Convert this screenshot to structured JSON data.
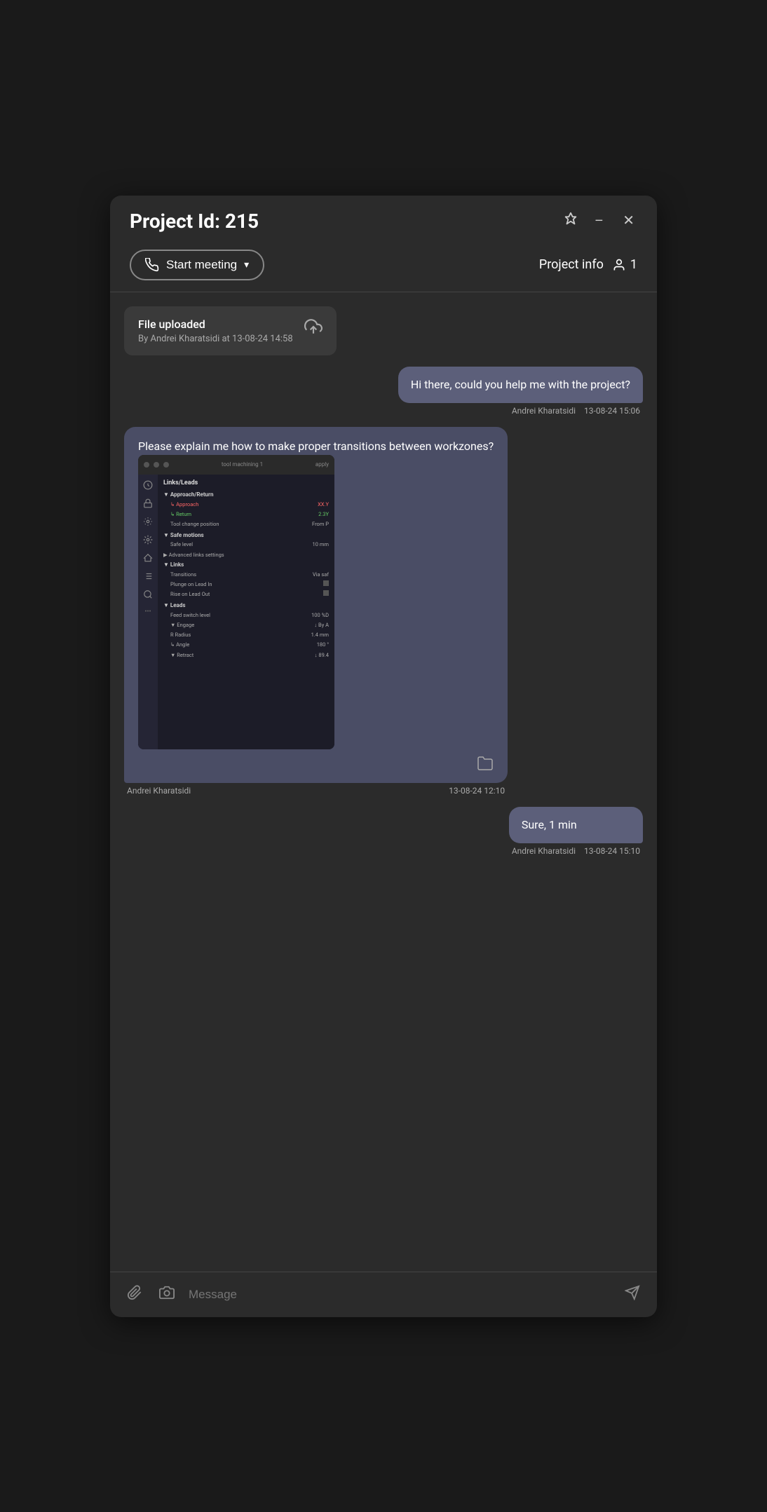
{
  "window": {
    "title": "Project Id: 215",
    "pin_icon": "📌",
    "minimize_icon": "−",
    "close_icon": "✕"
  },
  "action_bar": {
    "start_meeting_label": "Start meeting",
    "chevron": "⌄",
    "project_info_label": "Project info",
    "user_count": "1"
  },
  "messages": [
    {
      "type": "file_notification",
      "title": "File uploaded",
      "subtitle": "By Andrei Kharatsidi at 13-08-24 14:58"
    },
    {
      "type": "outgoing",
      "text": "Hi there, could you help me with the project?",
      "sender": "Andrei Kharatsidi",
      "timestamp": "13-08-24 15:06"
    },
    {
      "type": "incoming",
      "text": "Please explain me how to make proper transitions between workzones?",
      "sender": "Andrei Kharatsidi",
      "timestamp": "13-08-24 12:10",
      "has_screenshot": true
    },
    {
      "type": "outgoing",
      "text": "Sure, 1 min",
      "sender": "Andrei Kharatsidi",
      "timestamp": "13-08-24 15:10"
    }
  ],
  "input_bar": {
    "placeholder": "Message",
    "paperclip_icon": "📎",
    "camera_icon": "📷",
    "send_icon": "➤"
  },
  "screenshot_sections": [
    {
      "header": "Links/Leads",
      "rows": [
        {
          "label": "▼ Approach/Return",
          "value": ""
        },
        {
          "label": "  ↳ Approach",
          "value": "XX.Y",
          "class": "highlight"
        },
        {
          "label": "  ↳ Return",
          "value": "2.3Y",
          "class": "highlight"
        },
        {
          "label": "  Tool change position",
          "value": "From P",
          "class": ""
        }
      ]
    },
    {
      "header": "Safe motions",
      "rows": [
        {
          "label": "▼ Safe motions",
          "value": ""
        },
        {
          "label": "   Safe level",
          "value": "10 mm",
          "class": ""
        }
      ]
    },
    {
      "header": "Advanced links settings",
      "rows": []
    },
    {
      "header": "Links",
      "rows": [
        {
          "label": "▼ Links",
          "value": ""
        },
        {
          "label": "  Transitions",
          "value": "Via saf",
          "class": ""
        },
        {
          "label": "  Plunge on Lead In",
          "value": "■",
          "class": ""
        },
        {
          "label": "  Rise on Lead Out",
          "value": "■",
          "class": ""
        }
      ]
    },
    {
      "header": "Leads",
      "rows": [
        {
          "label": "▼ Leads",
          "value": ""
        },
        {
          "label": "  Feed switch level",
          "value": "100 %D",
          "class": ""
        },
        {
          "label": "  ▼ Engage",
          "value": "↓ By A",
          "class": ""
        },
        {
          "label": "    R Radius",
          "value": "1.4 mm",
          "class": ""
        },
        {
          "label": "    ↳ Angle",
          "value": "180 °",
          "class": ""
        },
        {
          "label": "  ▼ Retract",
          "value": "↓ 89.4",
          "class": ""
        }
      ]
    }
  ]
}
